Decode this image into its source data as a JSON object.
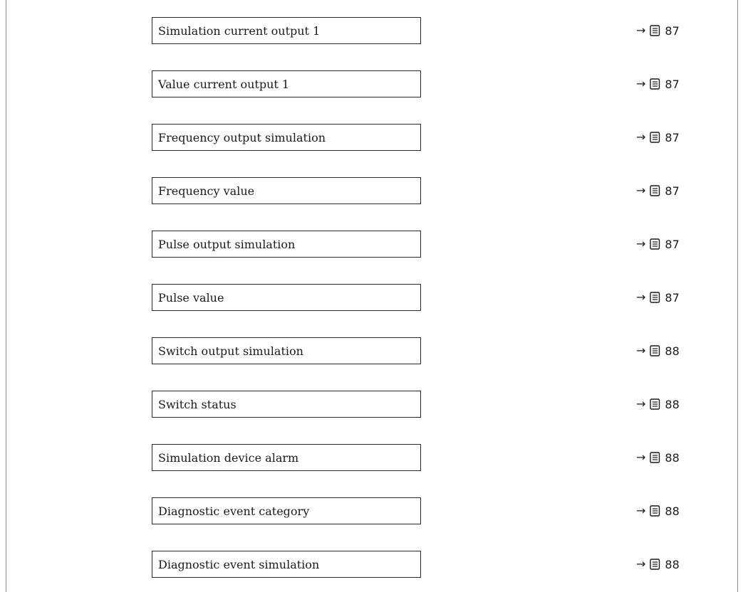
{
  "parameters": [
    {
      "label": "Simulation current output 1",
      "arrow": "→",
      "page": "87"
    },
    {
      "label": "Value current output 1",
      "arrow": "→",
      "page": "87"
    },
    {
      "label": "Frequency output simulation",
      "arrow": "→",
      "page": "87"
    },
    {
      "label": "Frequency value",
      "arrow": "→",
      "page": "87"
    },
    {
      "label": "Pulse output simulation",
      "arrow": "→",
      "page": "87"
    },
    {
      "label": "Pulse value",
      "arrow": "→",
      "page": "87"
    },
    {
      "label": "Switch output simulation",
      "arrow": "→",
      "page": "88"
    },
    {
      "label": "Switch status",
      "arrow": "→",
      "page": "88"
    },
    {
      "label": "Simulation device alarm",
      "arrow": "→",
      "page": "88"
    },
    {
      "label": "Diagnostic event category",
      "arrow": "→",
      "page": "88"
    },
    {
      "label": "Diagnostic event simulation",
      "arrow": "→",
      "page": "88"
    }
  ],
  "icons": {
    "arrow": "right-arrow-icon",
    "page_reference": "book-icon"
  }
}
